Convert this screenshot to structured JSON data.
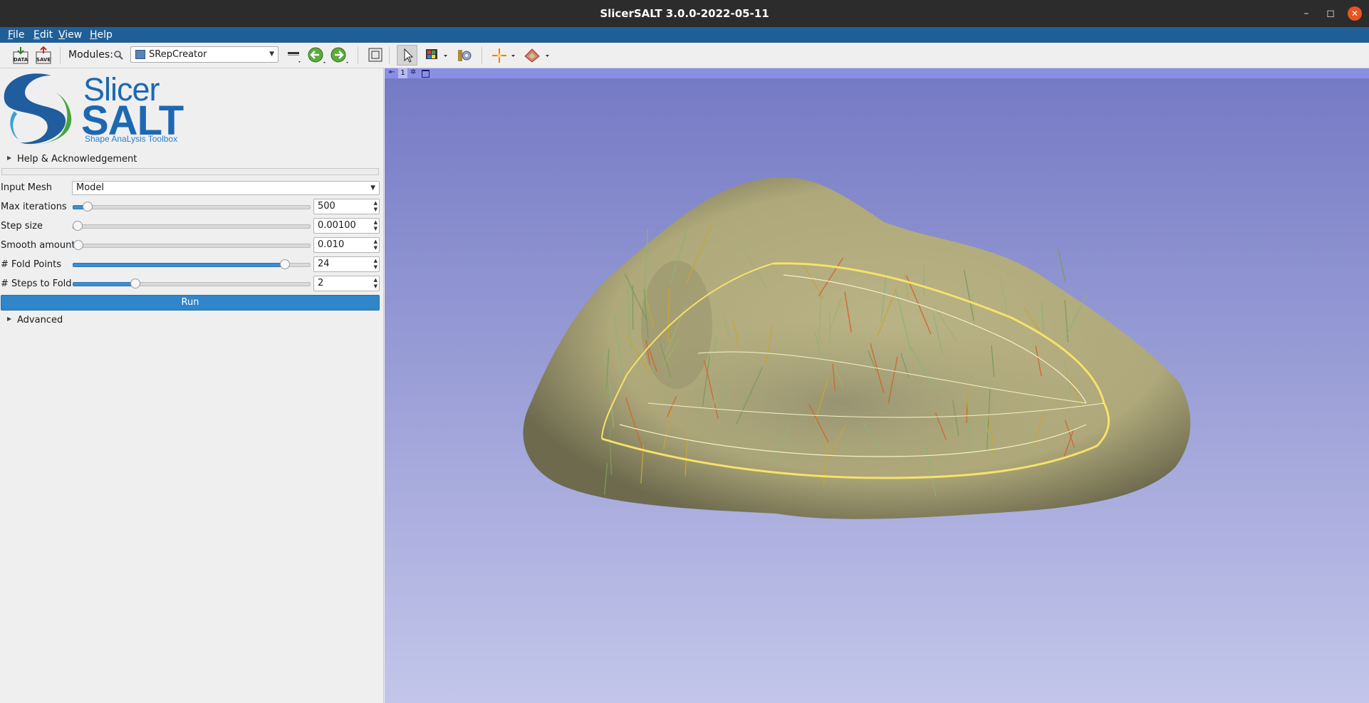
{
  "window": {
    "title": "SlicerSALT 3.0.0-2022-05-11",
    "controls": {
      "minimize": "–",
      "maximize": "◻",
      "close": "✕"
    }
  },
  "menu": [
    "File",
    "Edit",
    "View",
    "Help"
  ],
  "toolbar": {
    "modules_label": "Modules:",
    "module_selected": "SRepCreator",
    "data_label": "DATA",
    "save_label": "SAVE"
  },
  "logo": {
    "line1": "Slicer",
    "line2": "SALT",
    "tagline": "Shape AnaLysis Toolbox"
  },
  "panel": {
    "help_section": "Help & Acknowledgement",
    "input_mesh_label": "Input Mesh",
    "input_mesh_value": "Model",
    "rows": [
      {
        "label": "Max iterations",
        "value": "500",
        "level": 0.06
      },
      {
        "label": "Step size",
        "value": "0.00100",
        "level": 0.0
      },
      {
        "label": "Smooth amount",
        "value": "0.010",
        "level": 0.02
      },
      {
        "label": "# Fold Points",
        "value": "24",
        "level": 0.89
      },
      {
        "label": "# Steps to Fold",
        "value": "2",
        "level": 0.26
      }
    ],
    "run_label": "Run",
    "advanced_section": "Advanced"
  },
  "view": {
    "number": "1",
    "background_top": "#7479c4",
    "background_bottom": "#c3c6ea",
    "surface_color": "#b5b07c"
  }
}
